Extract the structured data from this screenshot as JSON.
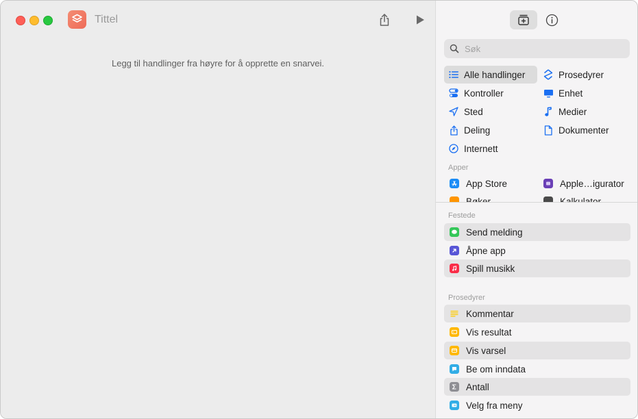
{
  "window": {
    "title": "Tittel"
  },
  "editor": {
    "hint": "Legg til handlinger fra høyre for å opprette en snarvei."
  },
  "search": {
    "placeholder": "Søk"
  },
  "categories": [
    {
      "label": "Alle handlinger",
      "icon": "list-icon"
    },
    {
      "label": "Prosedyrer",
      "icon": "scripting-icon"
    },
    {
      "label": "Kontroller",
      "icon": "toggle-icon"
    },
    {
      "label": "Enhet",
      "icon": "display-icon"
    },
    {
      "label": "Sted",
      "icon": "location-icon"
    },
    {
      "label": "Medier",
      "icon": "music-note-icon"
    },
    {
      "label": "Deling",
      "icon": "share-icon"
    },
    {
      "label": "Dokumenter",
      "icon": "document-icon"
    },
    {
      "label": "Internett",
      "icon": "compass-icon"
    }
  ],
  "apps": {
    "label": "Apper",
    "items": [
      {
        "label": "App Store",
        "color": "#1b8cf6"
      },
      {
        "label": "Apple…igurator",
        "color": "#6a3fb6"
      },
      {
        "label": "Bøker",
        "color": "#ff9500"
      },
      {
        "label": "Kalkulator",
        "color": "#4a4a4a"
      }
    ]
  },
  "pinned": {
    "label": "Festede",
    "items": [
      {
        "label": "Send melding",
        "color": "#34c759"
      },
      {
        "label": "Åpne app",
        "color": "#5856d6"
      },
      {
        "label": "Spill musikk",
        "color": "#fa2d48"
      }
    ]
  },
  "scripting": {
    "label": "Prosedyrer",
    "items": [
      {
        "label": "Kommentar",
        "color": "#ffcc00"
      },
      {
        "label": "Vis resultat",
        "color": "#ffb800"
      },
      {
        "label": "Vis varsel",
        "color": "#ffb800"
      },
      {
        "label": "Be om inndata",
        "color": "#32ade6"
      },
      {
        "label": "Antall",
        "color": "#8e8e93"
      },
      {
        "label": "Velg fra meny",
        "color": "#32ade6"
      }
    ]
  },
  "colors": {
    "accent": "#1a6ff2",
    "close": "#fe5f57",
    "minimize": "#febc2e",
    "maximize": "#28c840",
    "app_icon": "#ef7560"
  }
}
